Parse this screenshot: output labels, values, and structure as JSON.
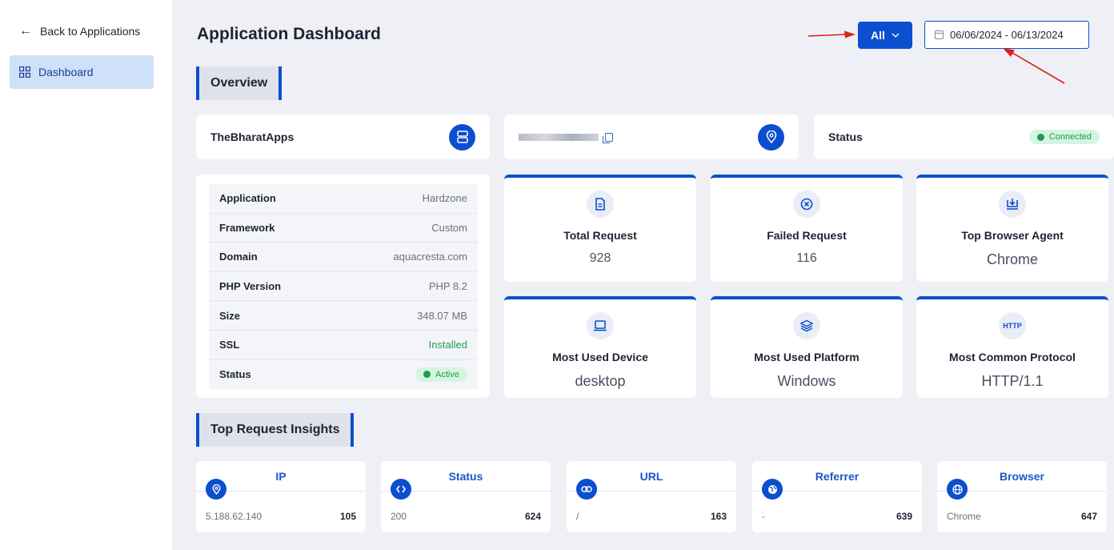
{
  "sidebar": {
    "back_label": "Back to Applications",
    "items": [
      {
        "label": "Dashboard",
        "icon": "grid-icon"
      }
    ]
  },
  "header": {
    "title": "Application Dashboard",
    "filter_label": "All",
    "date_range": "06/06/2024 - 06/13/2024"
  },
  "overview": {
    "section_title": "Overview",
    "app_name": "TheBharatApps",
    "status_label": "Status",
    "status_badge": "Connected",
    "details": [
      {
        "key": "Application",
        "value": "Hardzone"
      },
      {
        "key": "Framework",
        "value": "Custom"
      },
      {
        "key": "Domain",
        "value": "aquacresta.com"
      },
      {
        "key": "PHP Version",
        "value": "PHP 8.2"
      },
      {
        "key": "Size",
        "value": "348.07 MB"
      },
      {
        "key": "SSL",
        "value": "Installed"
      },
      {
        "key": "Status",
        "value": "Active"
      }
    ],
    "stats": [
      {
        "label": "Total Request",
        "value": "928",
        "icon": "document-icon"
      },
      {
        "label": "Failed Request",
        "value": "116",
        "icon": "x-circle-icon"
      },
      {
        "label": "Top Browser Agent",
        "value": "Chrome",
        "icon": "download-monitor-icon"
      },
      {
        "label": "Most Used Device",
        "value": "desktop",
        "icon": "laptop-icon"
      },
      {
        "label": "Most Used Platform",
        "value": "Windows",
        "icon": "layers-icon"
      },
      {
        "label": "Most Common Protocol",
        "value": "HTTP/1.1",
        "icon": "http-icon",
        "icon_text": "HTTP"
      }
    ]
  },
  "insights": {
    "section_title": "Top Request Insights",
    "cards": [
      {
        "title": "IP",
        "key": "5.188.62.140",
        "value": "105",
        "icon": "location-pin-icon"
      },
      {
        "title": "Status",
        "key": "200",
        "value": "624",
        "icon": "code-icon"
      },
      {
        "title": "URL",
        "key": "/",
        "value": "163",
        "icon": "link-icon"
      },
      {
        "title": "Referrer",
        "key": "-",
        "value": "639",
        "icon": "globe-icon"
      },
      {
        "title": "Browser",
        "key": "Chrome",
        "value": "647",
        "icon": "globe-grid-icon"
      }
    ]
  },
  "colors": {
    "accent": "#0b4fcf",
    "annotation_arrow": "#e0201a",
    "success": "#1e9a4f"
  }
}
